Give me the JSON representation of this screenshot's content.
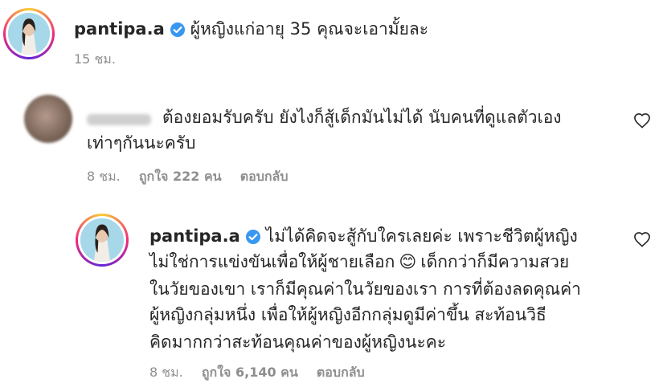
{
  "post": {
    "username": "pantipa.a",
    "caption": "ผู้หญิงแก่อายุ 35 คุณจะเอามั้ยละ",
    "time": "15 ชม."
  },
  "comment": {
    "text_line1": "ต้องยอมรับครับ ยังไงก็สู้เด็กมันไม่ได้ นับคนที่ดูแลตัวเอง",
    "text_line2": "เท่าๆกันนะครับ",
    "time": "8 ชม.",
    "likes": "ถูกใจ 222 คน",
    "reply_label": "ตอบกลับ"
  },
  "reply": {
    "username": "pantipa.a",
    "line1": "ไม่ได้คิดจะสู้กับใครเลยค่ะ เพราะชีวิตผู้หญิง",
    "line2_a": "ไม่ใช่การแข่งขันเพื่อให้ผู้ชายเลือก",
    "emoji": "😊",
    "line2_b": "เด็กกว่าก็มีความสวย",
    "line3": "ในวัยของเขา เราก็มีคุณค่าในวัยของเรา การที่ต้องลดคุณค่า",
    "line4": "ผู้หญิงกลุ่มหนึ่ง เพื่อให้ผู้หญิงอีกกลุ่มดูมีค่าขึ้น สะท้อนวิธี",
    "line5": "คิดมากกว่าสะท้อนคุณค่าของผู้หญิงนะคะ",
    "time": "8 ชม.",
    "likes": "ถูกใจ 6,140 คน",
    "reply_label": "ตอบกลับ"
  },
  "icons": {
    "verified": "verified-badge-icon",
    "like": "heart-icon"
  },
  "colors": {
    "verified": "#3897f0",
    "meta": "#8e8e8e"
  }
}
